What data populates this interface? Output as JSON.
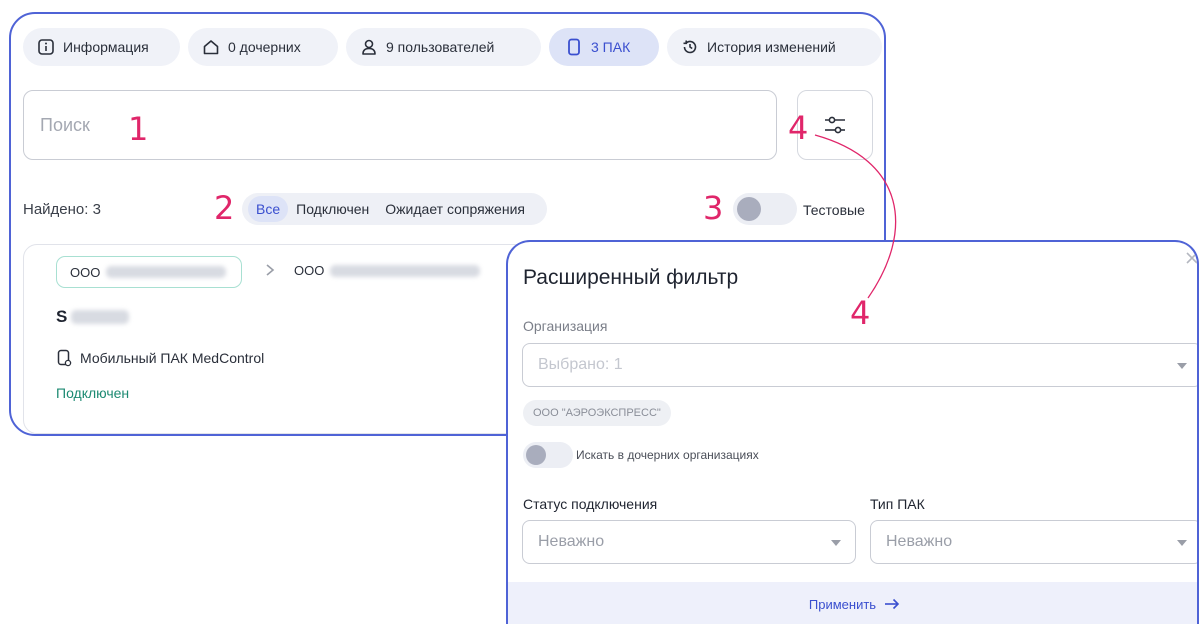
{
  "tabs": [
    {
      "label": "Информация",
      "icon": "info-icon"
    },
    {
      "label": "0 дочерних",
      "icon": "home-icon"
    },
    {
      "label": "9 пользователей",
      "icon": "user-icon"
    },
    {
      "label": "3 ПАК",
      "icon": "device-icon",
      "active": true
    },
    {
      "label": "История изменений",
      "icon": "history-icon"
    }
  ],
  "search": {
    "placeholder": "Поиск"
  },
  "results": {
    "found_label": "Найдено: 3"
  },
  "status_filter": {
    "all": "Все",
    "connected": "Подключен",
    "awaiting": "Ожидает сопряжения"
  },
  "test_toggle": {
    "label": "Тестовые",
    "on": false
  },
  "card": {
    "org_prefix": "ООО",
    "org2_prefix": "ООО",
    "serial_prefix": "S",
    "device_name": "Мобильный ПАК MedControl",
    "status": "Подключен"
  },
  "annotations": {
    "n1": "1",
    "n2": "2",
    "n3": "3",
    "n4a": "4",
    "n4b": "4"
  },
  "filter_panel": {
    "title": "Расширенный фильтр",
    "org_label": "Организация",
    "org_value": "Выбрано: 1",
    "org_tag": "ООО \"АЭРОЭКСПРЕСС\"",
    "child_label": "Искать в дочерних организациях",
    "status_label": "Статус подключения",
    "status_value": "Неважно",
    "type_label": "Тип ПАК",
    "type_value": "Неважно",
    "apply_label": "Применить"
  },
  "colors": {
    "accent": "#4f63d6",
    "annotation": "#e0266a",
    "status_green": "#1c8a72",
    "chip_border": "#a8e0d2"
  }
}
